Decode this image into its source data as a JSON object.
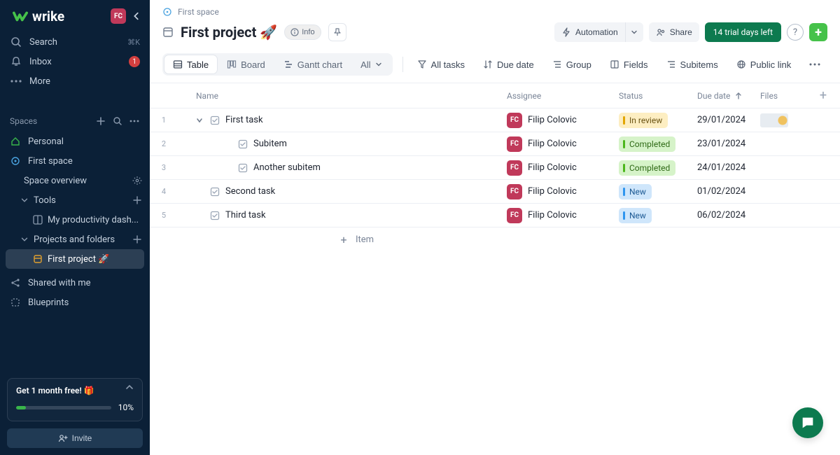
{
  "product_name": "wrike",
  "user_initials": "FC",
  "sidebar": {
    "search_label": "Search",
    "search_kbd": "⌘K",
    "inbox_label": "Inbox",
    "inbox_count": "1",
    "more_label": "More",
    "spaces_header": "Spaces",
    "personal_label": "Personal",
    "first_space_label": "First space",
    "space_overview_label": "Space overview",
    "tools_label": "Tools",
    "dashboard_label": "My productivity dash...",
    "projects_folders_label": "Projects and folders",
    "first_project_label": "First project 🚀",
    "shared_label": "Shared with me",
    "blueprints_label": "Blueprints",
    "promo_title": "Get 1 month free! 🎁",
    "promo_pct_text": "10%",
    "promo_pct_value": 10,
    "invite_label": "Invite"
  },
  "breadcrumb": {
    "space": "First space"
  },
  "header": {
    "project_title": "First project 🚀",
    "info_label": "Info",
    "automation_label": "Automation",
    "share_label": "Share",
    "trial_label": "14 trial days left"
  },
  "views": {
    "table": "Table",
    "board": "Board",
    "gantt": "Gantt chart",
    "all": "All"
  },
  "toolbar": {
    "all_tasks": "All tasks",
    "due_date": "Due date",
    "group": "Group",
    "fields": "Fields",
    "subitems": "Subitems",
    "public_link": "Public link"
  },
  "columns": {
    "name": "Name",
    "assignee": "Assignee",
    "status": "Status",
    "due_date": "Due date",
    "files": "Files"
  },
  "status_labels": {
    "in_review": "In review",
    "completed": "Completed",
    "new": "New"
  },
  "assignee_name": "Filip Colovic",
  "rows": [
    {
      "num": "1",
      "depth": 0,
      "caret": true,
      "name": "First task",
      "status": "in_review",
      "due": "29/01/2024",
      "file": true
    },
    {
      "num": "2",
      "depth": 1,
      "caret": false,
      "name": "Subitem",
      "status": "completed",
      "due": "23/01/2024",
      "file": false
    },
    {
      "num": "3",
      "depth": 1,
      "caret": false,
      "name": "Another subitem",
      "status": "completed",
      "due": "24/01/2024",
      "file": false
    },
    {
      "num": "4",
      "depth": 0,
      "caret": false,
      "name": "Second task",
      "status": "new",
      "due": "01/02/2024",
      "file": false
    },
    {
      "num": "5",
      "depth": 0,
      "caret": false,
      "name": "Third task",
      "status": "new",
      "due": "06/02/2024",
      "file": false
    }
  ],
  "add_item_label": "Item"
}
